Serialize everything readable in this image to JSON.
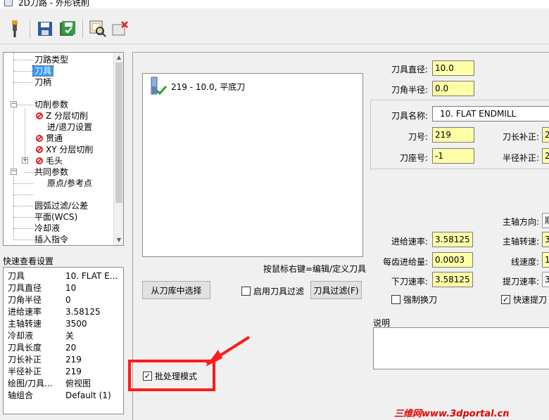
{
  "window": {
    "title": "2D刀路 - 外形铣削"
  },
  "toolbar": {
    "icons": [
      "tool-icon",
      "save-icon",
      "save-all-icon",
      "preview-icon",
      "delete-icon"
    ]
  },
  "tree": {
    "items": [
      {
        "label": "刀路类型"
      },
      {
        "label": "刀具"
      },
      {
        "label": "刀柄"
      },
      {
        "label": "切削参数"
      },
      {
        "label": "Z 分层切削"
      },
      {
        "label": "进/退刀设置"
      },
      {
        "label": "贯通"
      },
      {
        "label": "XY 分层切削"
      },
      {
        "label": "毛头"
      },
      {
        "label": "共同参数"
      },
      {
        "label": "原点/参考点"
      },
      {
        "label": "圆弧过滤/公差"
      },
      {
        "label": "平面(WCS)"
      },
      {
        "label": "冷却液"
      },
      {
        "label": "插入指令"
      }
    ]
  },
  "quick": {
    "title": "快速查看设置",
    "rows": [
      {
        "k": "刀具",
        "v": "10. FLAT E..."
      },
      {
        "k": "刀具直径",
        "v": "10"
      },
      {
        "k": "刀角半径",
        "v": "0"
      },
      {
        "k": "进给速率",
        "v": "3.58125"
      },
      {
        "k": "主轴转速",
        "v": "3500"
      },
      {
        "k": "冷却液",
        "v": "关"
      },
      {
        "k": "刀具长度",
        "v": "20"
      },
      {
        "k": "刀长补正",
        "v": "219"
      },
      {
        "k": "半径补正",
        "v": "219"
      },
      {
        "k": "绘图/刀具...",
        "v": "俯视图"
      },
      {
        "k": "轴组合",
        "v": "Default (1)"
      }
    ]
  },
  "tool_list": {
    "entry": "219 - 10.0, 平底刀",
    "hint": "按鼠标右键=编辑/定义刀具"
  },
  "buttons": {
    "from_library": "从刀库中选择",
    "filter": "刀具过滤(F)"
  },
  "checks": {
    "enable_filter": "启用刀具过滤",
    "batch_mode": "批处理模式",
    "force_change": "强制换刀",
    "quick_retract": "快速提刀"
  },
  "params": {
    "diameter_label": "刀具直径:",
    "diameter": "10.0",
    "corner_label": "刀角半径:",
    "corner": "0.0",
    "name_label": "刀具名称:",
    "name": "10. FLAT ENDMILL",
    "number_label": "刀号:",
    "number": "219",
    "length_comp_label": "刀长补正:",
    "length_comp": "2",
    "holder_label": "刀座号:",
    "holder": "-1",
    "radius_comp_label": "半径补正:",
    "radius_comp": "2",
    "spindle_dir_label": "主轴方向:",
    "spindle_dir": "順",
    "feed_label": "进给速率:",
    "feed": "3.58125",
    "spindle_label": "主轴转速:",
    "spindle": "3",
    "per_tooth_label": "每齿进给量:",
    "per_tooth": "0.0003",
    "surface_label": "线速度:",
    "surface": "1",
    "plunge_label": "下刀速率:",
    "plunge": "3.58125",
    "retract_label": "提刀速率:",
    "retract": "3"
  },
  "desc": {
    "label": "说明"
  },
  "watermark": "三维网www.3dportal.cn",
  "colors": {
    "highlight": "#ff1a1a",
    "field": "#ffffa8",
    "selection": "#3399ff"
  }
}
